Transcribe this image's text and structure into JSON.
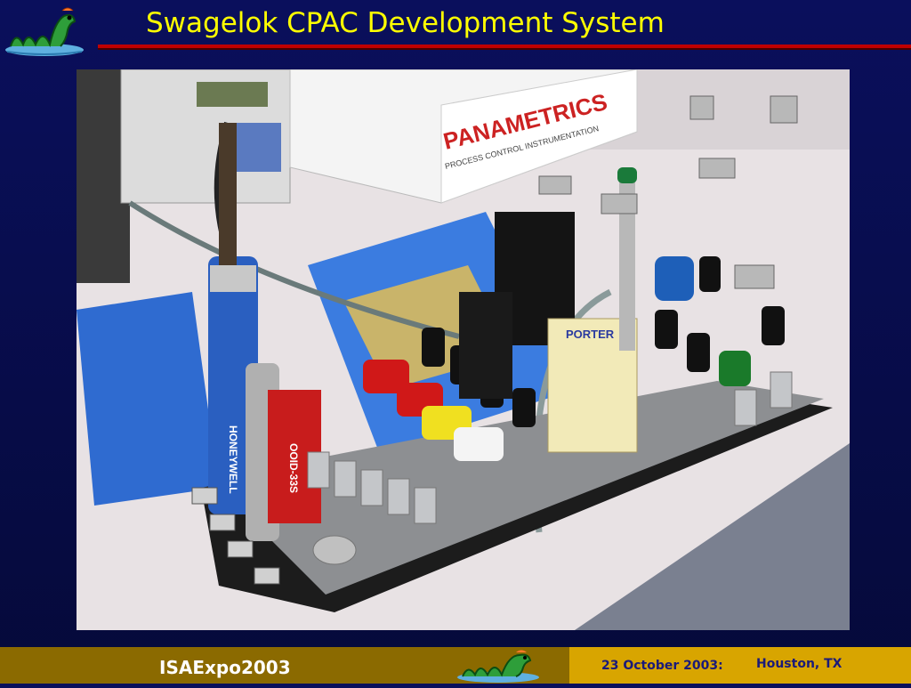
{
  "slide": {
    "title": "Swagelok CPAC Development System"
  },
  "photo": {
    "alt_label": "PANAMETRICS",
    "box_subtitle": "PROCESS CONTROL INSTRUMENTATION",
    "device_label": "PORTER",
    "canister_label": "HONEYWELL",
    "red_module_label": "OOID-33S"
  },
  "footer": {
    "event": "ISAExpo2003",
    "date": "23 October 2003:",
    "location": "Houston, TX"
  },
  "colors": {
    "background": "#0a0f5c",
    "title": "#ffff00",
    "rule": "#c00000",
    "footer_left": "#8b6a00",
    "footer_right": "#d8a500"
  }
}
